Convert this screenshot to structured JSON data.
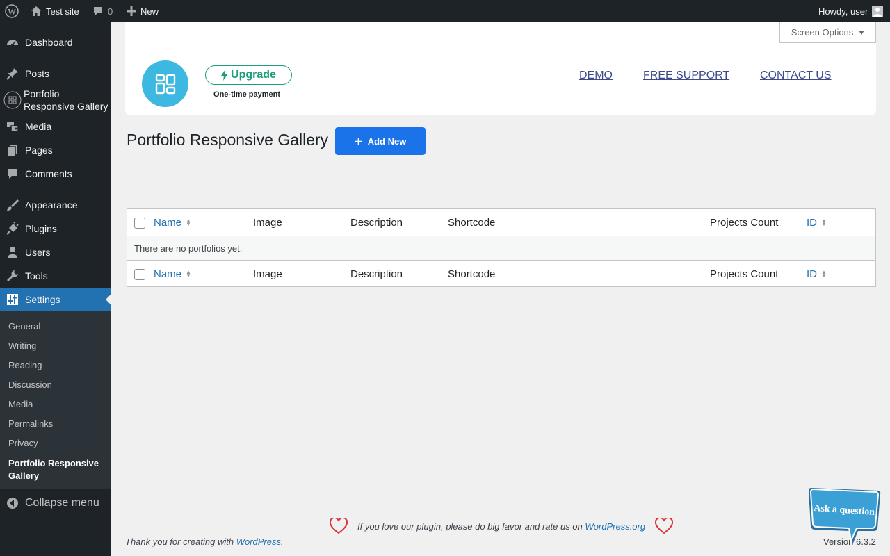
{
  "adminbar": {
    "site_name": "Test site",
    "comments_count": "0",
    "new_label": "New",
    "howdy": "Howdy, user"
  },
  "sidebar": {
    "items": [
      {
        "label": "Dashboard",
        "icon": "dashboard-icon"
      },
      {
        "label": "Posts",
        "icon": "pin-icon"
      },
      {
        "label": "Portfolio Responsive Gallery",
        "icon": "gallery-icon"
      },
      {
        "label": "Media",
        "icon": "media-icon"
      },
      {
        "label": "Pages",
        "icon": "pages-icon"
      },
      {
        "label": "Comments",
        "icon": "comments-icon"
      },
      {
        "label": "Appearance",
        "icon": "brush-icon"
      },
      {
        "label": "Plugins",
        "icon": "plugin-icon"
      },
      {
        "label": "Users",
        "icon": "users-icon"
      },
      {
        "label": "Tools",
        "icon": "wrench-icon"
      },
      {
        "label": "Settings",
        "icon": "settings-icon"
      }
    ],
    "submenu": [
      "General",
      "Writing",
      "Reading",
      "Discussion",
      "Media",
      "Permalinks",
      "Privacy",
      "Portfolio Responsive Gallery"
    ],
    "collapse_label": "Collapse menu"
  },
  "screen_options": "Screen Options",
  "plugin_header": {
    "upgrade_label": "Upgrade",
    "payment_note": "One-time payment",
    "links": [
      "DEMO",
      "FREE SUPPORT",
      "CONTACT US"
    ]
  },
  "page": {
    "title": "Portfolio Responsive Gallery",
    "add_new_label": "Add New"
  },
  "table": {
    "columns": [
      "Name",
      "Image",
      "Description",
      "Shortcode",
      "Projects Count",
      "ID"
    ],
    "empty_message": "There are no portfolios yet."
  },
  "footer": {
    "rate_text": "If you love our plugin, please do big favor and rate us on",
    "rate_link": "WordPress.org",
    "thanks_text": "Thank you for creating with",
    "thanks_link": "WordPress",
    "thanks_end": ".",
    "version": "Version 6.3.2",
    "ask_label": "Ask a question"
  },
  "colors": {
    "accent": "#2271b1",
    "add_new": "#1a73e8",
    "upgrade": "#1a9f7d",
    "logo": "#3db8e0"
  }
}
